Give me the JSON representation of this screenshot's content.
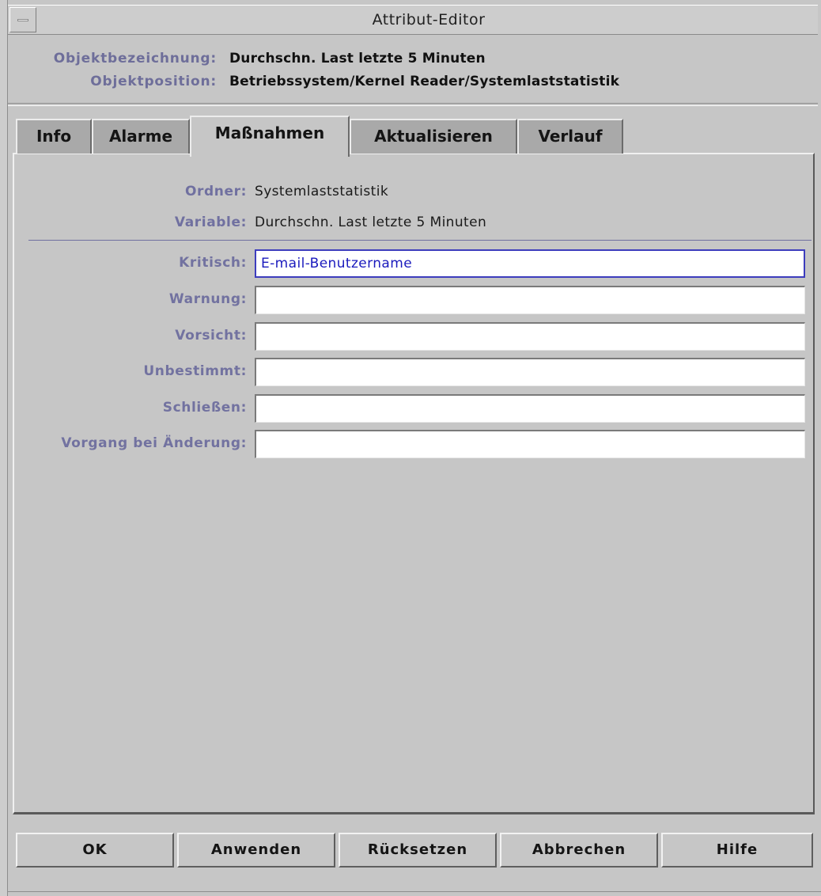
{
  "window": {
    "title": "Attribut-Editor"
  },
  "header": {
    "object_name_label": "Objektbezeichnung:",
    "object_name_value": "Durchschn. Last letzte 5 Minuten",
    "object_position_label": "Objektposition:",
    "object_position_value": "Betriebssystem/Kernel Reader/Systemlaststatistik"
  },
  "tabs": [
    {
      "label": "Info",
      "active": false
    },
    {
      "label": "Alarme",
      "active": false
    },
    {
      "label": "Maßnahmen",
      "active": true
    },
    {
      "label": "Aktualisieren",
      "active": false
    },
    {
      "label": "Verlauf",
      "active": false
    }
  ],
  "panel": {
    "folder_label": "Ordner:",
    "folder_value": "Systemlaststatistik",
    "variable_label": "Variable:",
    "variable_value": "Durchschn. Last letzte 5 Minuten",
    "fields": [
      {
        "label": "Kritisch:",
        "value": "E-mail-Benutzername",
        "focused": true
      },
      {
        "label": "Warnung:",
        "value": "",
        "focused": false
      },
      {
        "label": "Vorsicht:",
        "value": "",
        "focused": false
      },
      {
        "label": "Unbestimmt:",
        "value": "",
        "focused": false
      },
      {
        "label": "Schließen:",
        "value": "",
        "focused": false
      },
      {
        "label": "Vorgang bei Änderung:",
        "value": "",
        "focused": false
      }
    ]
  },
  "buttons": {
    "ok": "OK",
    "apply": "Anwenden",
    "reset": "Rücksetzen",
    "cancel": "Abbrechen",
    "help": "Hilfe"
  },
  "colors": {
    "label_color": "#7272a0",
    "focus_border": "#3d3dbd",
    "field_text": "#1b1bbd"
  },
  "icons": {
    "window_menu": "window-menu-icon"
  }
}
